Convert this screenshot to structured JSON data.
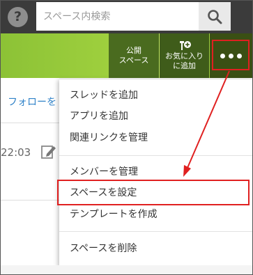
{
  "search": {
    "placeholder": "スペース内検索"
  },
  "header": {
    "public_label": "公開\nスペース",
    "public_line1": "公開",
    "public_line2": "スペース",
    "fav_line1": "お気に入り",
    "fav_line2": "に追加"
  },
  "content": {
    "follow_link": "フォローを",
    "time": "22:03"
  },
  "menu": {
    "items": [
      "スレッドを追加",
      "アプリを追加",
      "関連リンクを管理",
      "メンバーを管理",
      "スペースを設定",
      "テンプレートを作成",
      "スペースを削除"
    ]
  },
  "colors": {
    "topbar": "#3b3b3b",
    "green": "#8cc236",
    "annotation_red": "#e02020",
    "link_blue": "#2f82c8"
  },
  "icons": {
    "help": "question-circle-icon",
    "search": "magnifier-icon",
    "favorite": "pin-plus-icon",
    "more": "three-dots-icon",
    "edit": "pencil-icon"
  }
}
